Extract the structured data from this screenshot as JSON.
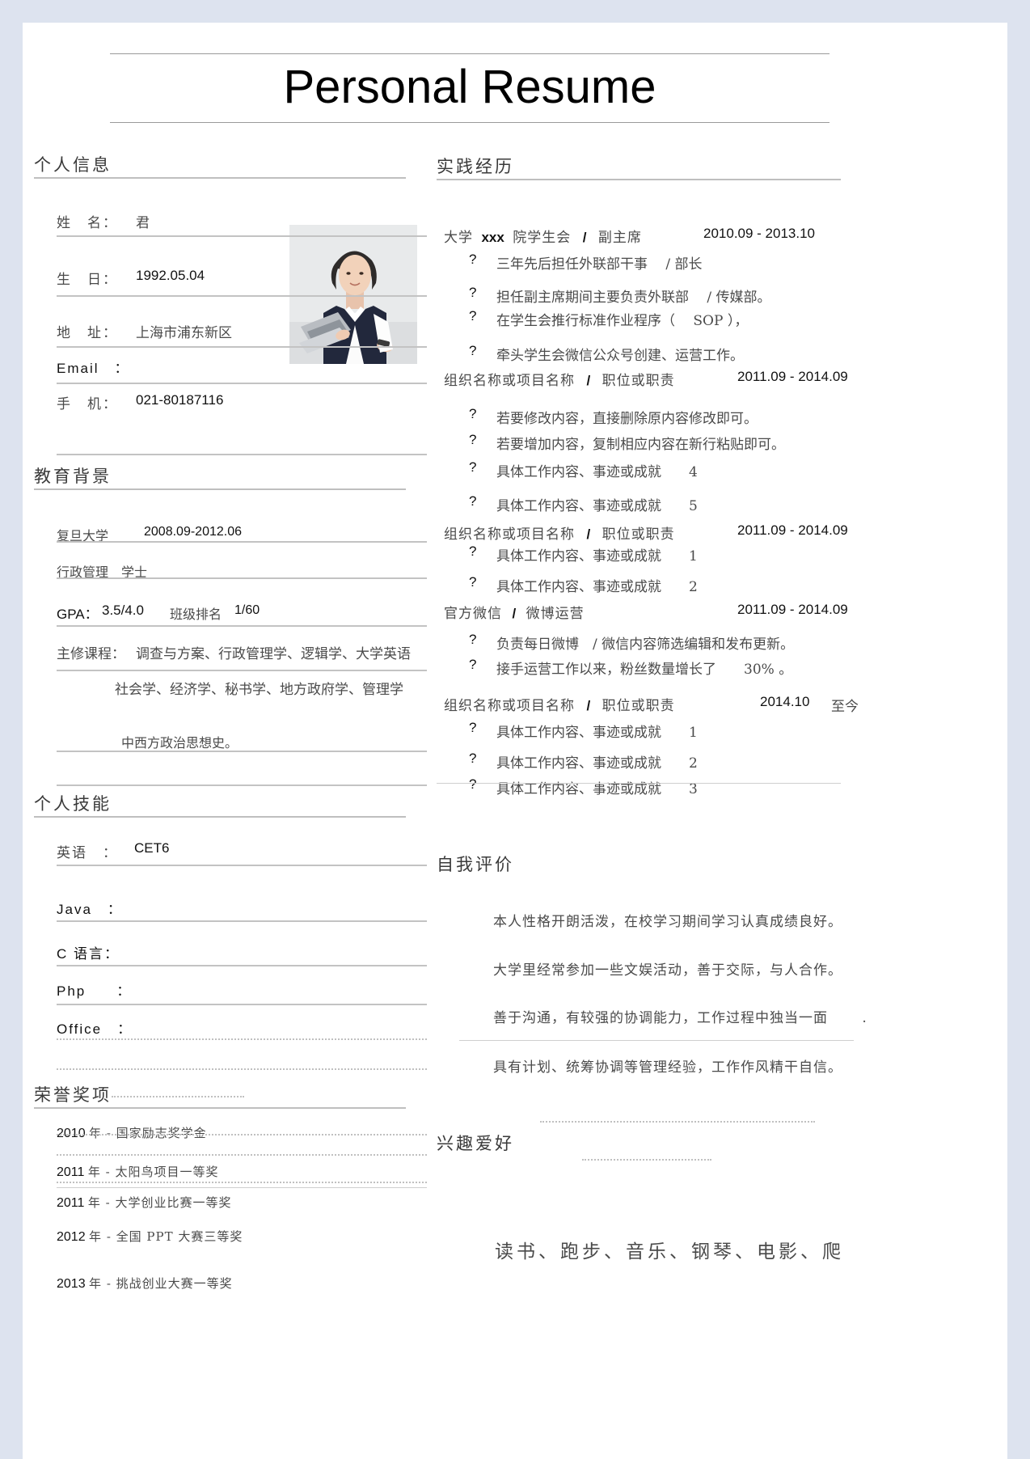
{
  "document": {
    "title": "Personal Resume"
  },
  "personal_info": {
    "heading": "个人信息",
    "fields": [
      {
        "label": "姓　名：",
        "value": "君"
      },
      {
        "label": "生　日：",
        "value": "1992.05.04"
      },
      {
        "label": "地　址：",
        "value": "上海市浦东新区"
      },
      {
        "label": "Email　：",
        "value": ""
      },
      {
        "label": "手　机：",
        "value": "021-80187116"
      }
    ],
    "photo_alt": "portrait-photo"
  },
  "education": {
    "heading": "教育背景",
    "school": "复旦大学",
    "period": "2008.09-2012.06",
    "major_degree": "行政管理　学士",
    "gpa_label": "GPA：",
    "gpa_value": "3.5/4.0",
    "rank_label": "班级排名",
    "rank_value": "1/60",
    "courses_label": "主修课程：",
    "courses_line1": "调查与方案、行政管理学、逻辑学、大学英语",
    "courses_line2": "社会学、经济学、秘书学、地方政府学、管理学",
    "courses_line3": "中西方政治思想史。"
  },
  "skills": {
    "heading": "个人技能",
    "items": [
      {
        "label": "英语　：",
        "value": "CET6"
      },
      {
        "label": "Java　：",
        "value": ""
      },
      {
        "label": "C 语言：",
        "value": ""
      },
      {
        "label": "Php　　：",
        "value": ""
      },
      {
        "label": "Office　：",
        "value": ""
      }
    ]
  },
  "honors": {
    "heading": "荣誉奖项",
    "items": [
      {
        "year": "2010",
        "text": "年 - 国家励志奖学金"
      },
      {
        "year": "2011",
        "text": "年 - 太阳鸟项目一等奖"
      },
      {
        "year": "2011",
        "text": "年 - 大学创业比赛一等奖"
      },
      {
        "year": "2012",
        "text": "年 - 全国 PPT 大赛三等奖"
      },
      {
        "year": "2013",
        "text": "年 - 挑战创业大赛一等奖"
      }
    ]
  },
  "experience": {
    "heading": "实践经历",
    "bullet_glyph": "?",
    "entries": [
      {
        "org_prefix": "大学",
        "org_mid": "xxx",
        "org_suffix": "院学生会",
        "slash": "/",
        "role": "副主席",
        "date": "2010.09 - 2013.10",
        "bullets": [
          "三年先后担任外联部干事　 / 部长",
          "担任副主席期间主要负责外联部　 / 传媒部。",
          "在学生会推行标准作业程序（　 SOP ），",
          "牵头学生会微信公众号创建、运营工作。"
        ]
      },
      {
        "org": "组织名称或项目名称",
        "slash": "/",
        "role": "职位或职责",
        "date": "2011.09 - 2014.09",
        "bullets": [
          "若要修改内容，直接删除原内容修改即可。",
          "若要增加内容，复制相应内容在新行粘贴即可。",
          "具体工作内容、事迹或成就　　4",
          "具体工作内容、事迹或成就　　5"
        ]
      },
      {
        "org": "组织名称或项目名称",
        "slash": "/",
        "role": "职位或职责",
        "date": "2011.09 - 2014.09",
        "bullets": [
          "具体工作内容、事迹或成就　　1",
          "具体工作内容、事迹或成就　　2"
        ]
      },
      {
        "org": "官方微信",
        "slash": "/",
        "role": "微博运营",
        "date": "2011.09 - 2014.09",
        "bullets": [
          "负责每日微博　/ 微信内容筛选编辑和发布更新。",
          "接手运营工作以来，粉丝数量增长了　　30% 。"
        ]
      },
      {
        "org": "组织名称或项目名称",
        "slash": "/",
        "role": "职位或职责",
        "date": "2014.10",
        "date_suffix": "至今",
        "bullets": [
          "具体工作内容、事迹或成就　　1",
          "具体工作内容、事迹或成就　　2",
          "具体工作内容、事迹或成就　　3"
        ]
      }
    ]
  },
  "self_evaluation": {
    "heading": "自我评价",
    "lines": [
      "本人性格开朗活泼，在校学习期间学习认真成绩良好。",
      "大学里经常参加一些文娱活动，善于交际，与人合作。",
      "善于沟通，有较强的协调能力，工作过程中独当一面　　 .",
      "具有计划、统筹协调等管理经验，工作作风精干自信。"
    ]
  },
  "interests": {
    "heading": "兴趣爱好",
    "text": "读书、跑步、音乐、钢琴、电影、爬"
  }
}
